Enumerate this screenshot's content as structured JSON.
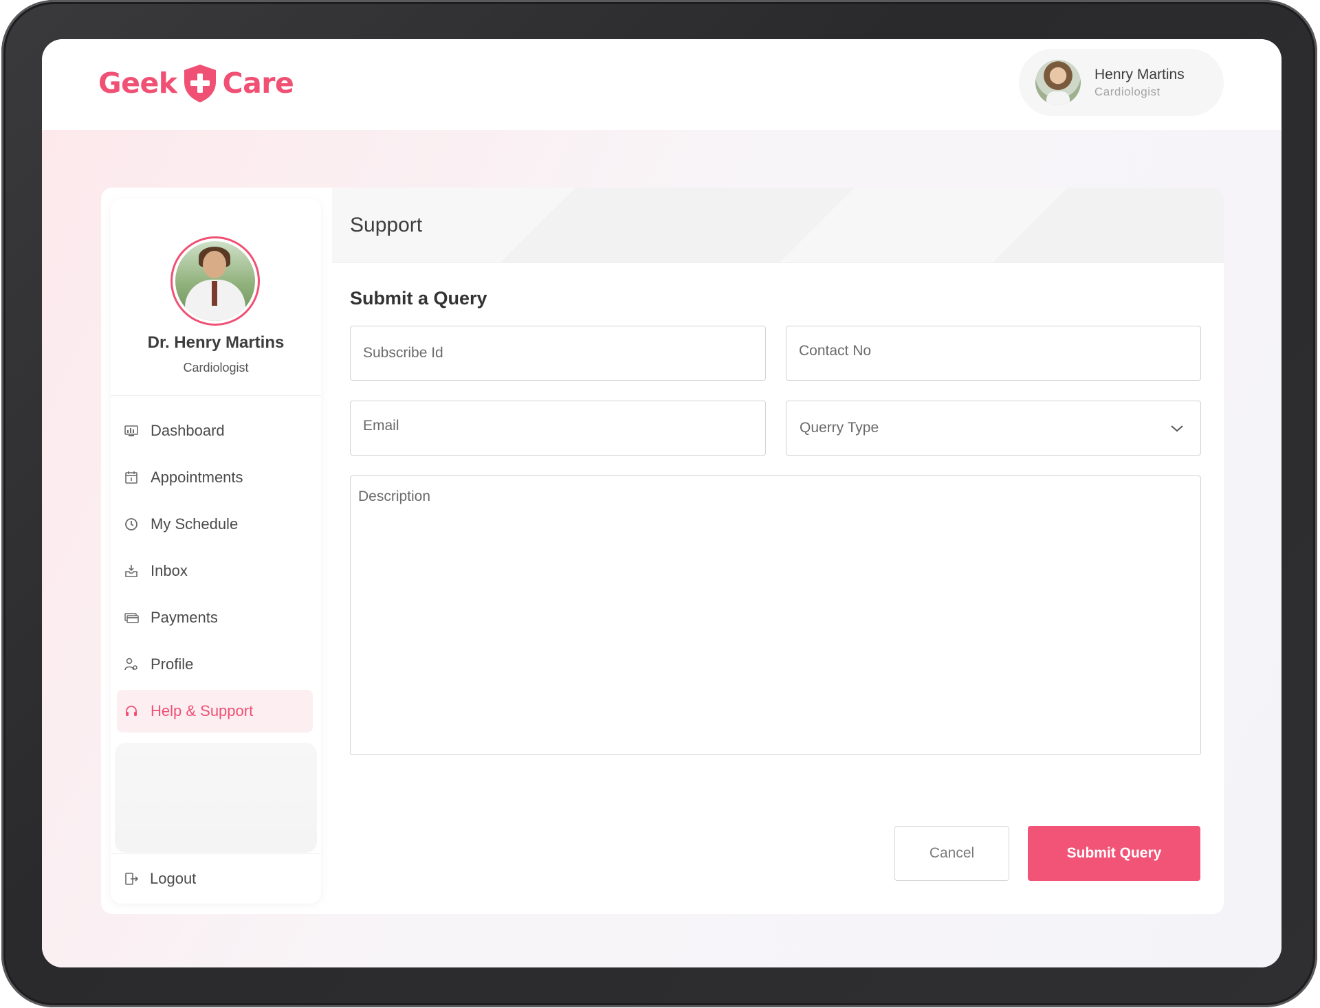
{
  "brand": {
    "logo_left": "Geek",
    "logo_right": "Care",
    "accent_color": "#ef5073"
  },
  "header_user": {
    "name": "Henry Martins",
    "role": "Cardiologist"
  },
  "sidebar": {
    "profile": {
      "name": "Dr. Henry Martins",
      "role": "Cardiologist"
    },
    "items": [
      {
        "label": "Dashboard",
        "icon": "dashboard-icon",
        "active": false
      },
      {
        "label": "Appointments",
        "icon": "calendar-icon",
        "active": false
      },
      {
        "label": "My Schedule",
        "icon": "clock-icon",
        "active": false
      },
      {
        "label": "Inbox",
        "icon": "inbox-icon",
        "active": false
      },
      {
        "label": "Payments",
        "icon": "credit-card-icon",
        "active": false
      },
      {
        "label": "Profile",
        "icon": "user-settings-icon",
        "active": false
      },
      {
        "label": "Help & Support",
        "icon": "headset-icon",
        "active": true
      }
    ],
    "logout_label": "Logout"
  },
  "main": {
    "title": "Support",
    "form": {
      "title": "Submit a Query",
      "subscribe_id_placeholder": "Subscribe Id",
      "contact_no_placeholder": "Contact No",
      "email_placeholder": "Email",
      "query_type_placeholder": "Querry Type",
      "description_placeholder": "Description",
      "cancel_label": "Cancel",
      "submit_label": "Submit Query"
    }
  }
}
